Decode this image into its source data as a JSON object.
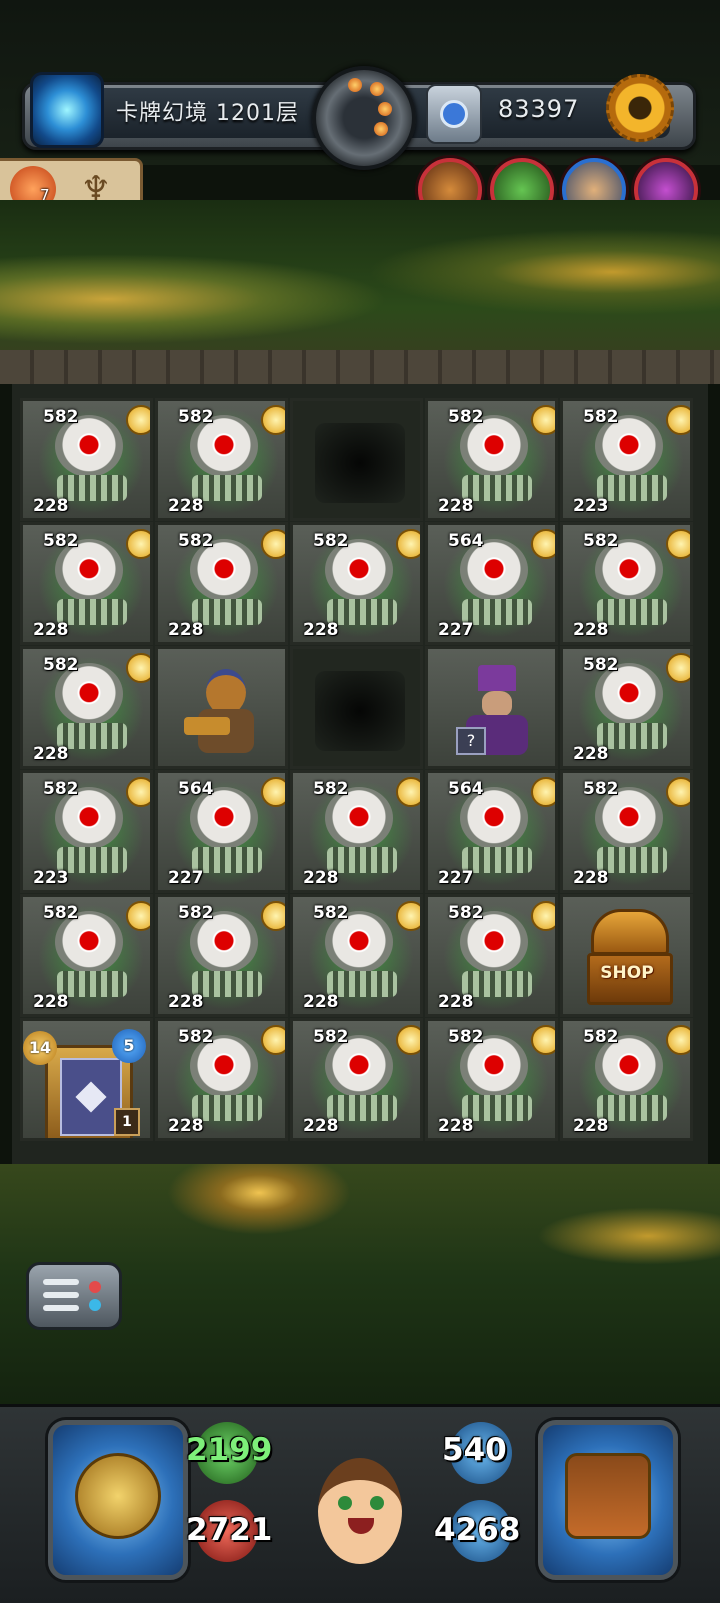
{
  "top_bar": {
    "floor_label": "卡牌幻境 1201层",
    "gem_count": "83397",
    "portal_icon": "portal-icon",
    "settings_icon": "gear-icon"
  },
  "status_panel": {
    "fire_count": "7",
    "fire_icon": "fire-fox-icon",
    "candle_icon": "candelabra-icon"
  },
  "allies": [
    "hammer-dwarf-icon",
    "goblin-icon",
    "warrior-icon",
    "demon-icon"
  ],
  "grid": {
    "rows": [
      [
        {
          "type": "monster",
          "atk": "582",
          "def": "228"
        },
        {
          "type": "monster",
          "atk": "582",
          "def": "228"
        },
        {
          "type": "empty"
        },
        {
          "type": "monster",
          "atk": "582",
          "def": "228"
        },
        {
          "type": "monster",
          "atk": "582",
          "def": "223"
        }
      ],
      [
        {
          "type": "monster",
          "atk": "582",
          "def": "228"
        },
        {
          "type": "monster",
          "atk": "582",
          "def": "228"
        },
        {
          "type": "monster",
          "atk": "582",
          "def": "228"
        },
        {
          "type": "monster",
          "atk": "564",
          "def": "227"
        },
        {
          "type": "monster",
          "atk": "582",
          "def": "228"
        }
      ],
      [
        {
          "type": "monster",
          "atk": "582",
          "def": "228"
        },
        {
          "type": "hero"
        },
        {
          "type": "empty"
        },
        {
          "type": "merchant"
        },
        {
          "type": "monster",
          "atk": "582",
          "def": "228"
        }
      ],
      [
        {
          "type": "monster",
          "atk": "582",
          "def": "223"
        },
        {
          "type": "monster",
          "atk": "564",
          "def": "227"
        },
        {
          "type": "monster",
          "atk": "582",
          "def": "228"
        },
        {
          "type": "monster",
          "atk": "564",
          "def": "227"
        },
        {
          "type": "monster",
          "atk": "582",
          "def": "228"
        }
      ],
      [
        {
          "type": "monster",
          "atk": "582",
          "def": "228"
        },
        {
          "type": "monster",
          "atk": "582",
          "def": "228"
        },
        {
          "type": "monster",
          "atk": "582",
          "def": "228"
        },
        {
          "type": "monster",
          "atk": "582",
          "def": "228"
        },
        {
          "type": "shop",
          "label": "SHOP"
        }
      ],
      [
        {
          "type": "card",
          "level": "14",
          "blue": "5",
          "count": "1"
        },
        {
          "type": "monster",
          "atk": "582",
          "def": "228"
        },
        {
          "type": "monster",
          "atk": "582",
          "def": "228"
        },
        {
          "type": "monster",
          "atk": "582",
          "def": "228"
        },
        {
          "type": "monster",
          "atk": "582",
          "def": "228"
        }
      ]
    ]
  },
  "hud": {
    "hp_top": "2199",
    "hp_bottom": "2721",
    "def_top": "540",
    "def_bottom": "4268",
    "left_button_icon": "compass-helmet-icon",
    "right_button_icon": "spellbook-icon"
  }
}
